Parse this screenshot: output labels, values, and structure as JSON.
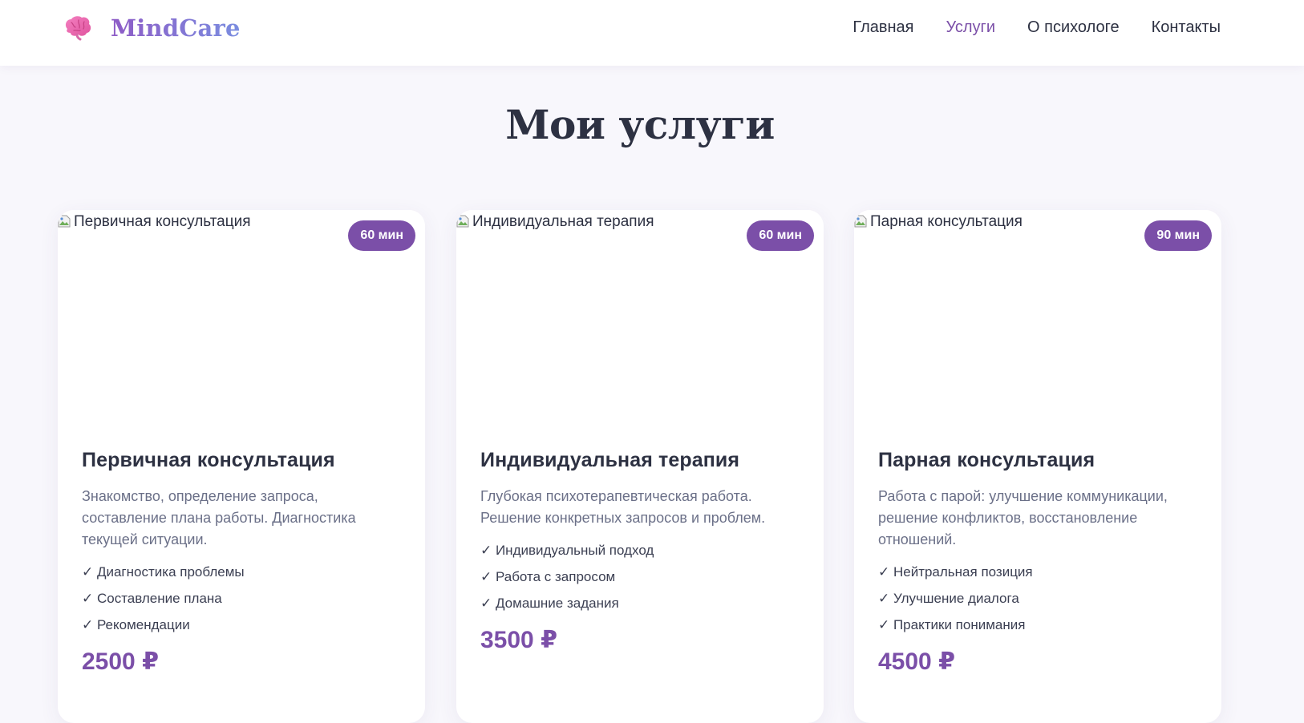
{
  "header": {
    "logo_text": "MindCare",
    "logo_icon": "brain-icon",
    "nav": [
      {
        "label": "Главная",
        "active": false
      },
      {
        "label": "Услуги",
        "active": true
      },
      {
        "label": "О психологе",
        "active": false
      },
      {
        "label": "Контакты",
        "active": false
      }
    ]
  },
  "colors": {
    "accent": "#7b4fa8",
    "logo_gradient_start": "#8e5bc6",
    "logo_gradient_end": "#7a8de0",
    "background": "#f8f7fc",
    "heading": "#2d3142",
    "muted_text": "#6b7088"
  },
  "services": {
    "title": "Мои услуги",
    "cards": [
      {
        "image_alt": "Первичная консультация",
        "duration": "60 мин",
        "title": "Первичная консультация",
        "description": "Знакомство, определение запроса, составление плана работы. Диагностика текущей ситуации.",
        "features": [
          "✓ Диагностика проблемы",
          "✓ Составление плана",
          "✓ Рекомендации"
        ],
        "price": "2500 ₽"
      },
      {
        "image_alt": "Индивидуальная терапия",
        "duration": "60 мин",
        "title": "Индивидуальная терапия",
        "description": "Глубокая психотерапевтическая работа. Решение конкретных запросов и проблем.",
        "features": [
          "✓ Индивидуальный подход",
          "✓ Работа с запросом",
          "✓ Домашние задания"
        ],
        "price": "3500 ₽"
      },
      {
        "image_alt": "Парная консультация",
        "duration": "90 мин",
        "title": "Парная консультация",
        "description": "Работа с парой: улучшение коммуникации, решение конфликтов, восстановление отношений.",
        "features": [
          "✓ Нейтральная позиция",
          "✓ Улучшение диалога",
          "✓ Практики понимания"
        ],
        "price": "4500 ₽"
      }
    ]
  }
}
